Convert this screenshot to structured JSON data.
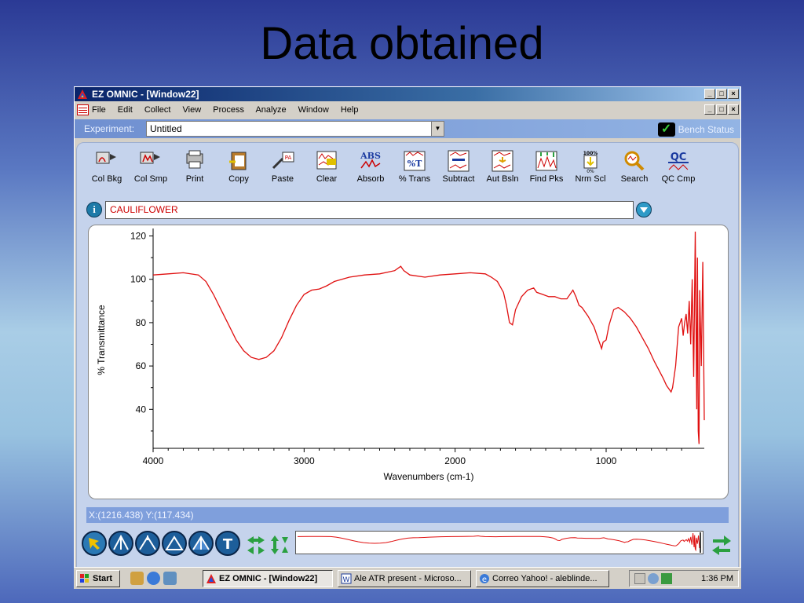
{
  "slide": {
    "title": "Data obtained"
  },
  "window": {
    "title": "EZ OMNIC - [Window22]",
    "controls": [
      "_",
      "□",
      "×"
    ]
  },
  "menu": {
    "items": [
      "File",
      "Edit",
      "Collect",
      "View",
      "Process",
      "Analyze",
      "Window",
      "Help"
    ]
  },
  "experiment": {
    "label": "Experiment:",
    "value": "Untitled",
    "bench_status": "Bench Status"
  },
  "toolbar": {
    "items": [
      {
        "label": "Col Bkg",
        "icon": "collect-background-icon"
      },
      {
        "label": "Col Smp",
        "icon": "collect-sample-icon"
      },
      {
        "label": "Print",
        "icon": "printer-icon"
      },
      {
        "label": "Copy",
        "icon": "clipboard-copy-icon"
      },
      {
        "label": "Paste",
        "icon": "paste-icon"
      },
      {
        "label": "Clear",
        "icon": "clear-icon"
      },
      {
        "label": "Absorb",
        "icon": "absorbance-icon",
        "glyph": "ABS"
      },
      {
        "label": "% Trans",
        "icon": "transmittance-icon",
        "glyph": "%T"
      },
      {
        "label": "Subtract",
        "icon": "subtract-icon"
      },
      {
        "label": "Aut Bsln",
        "icon": "auto-baseline-icon"
      },
      {
        "label": "Find Pks",
        "icon": "find-peaks-icon"
      },
      {
        "label": "Nrm Scl",
        "icon": "normal-scale-icon",
        "glyph": "100%"
      },
      {
        "label": "Search",
        "icon": "search-icon"
      },
      {
        "label": "QC Cmp",
        "icon": "qc-compare-icon",
        "glyph": "QC"
      }
    ]
  },
  "sample": {
    "name": "CAULIFLOWER"
  },
  "status": {
    "coordinates": "X:(1216.438) Y:(117.434)"
  },
  "taskbar": {
    "start": "Start",
    "buttons": [
      {
        "label": "EZ OMNIC - [Window22]",
        "active": true
      },
      {
        "label": "Ale ATR present - Microso...",
        "active": false
      },
      {
        "label": "Correo Yahoo! - aleblinde...",
        "active": false
      }
    ],
    "time": "1:36 PM"
  },
  "colors": {
    "spectrum": "#e01010",
    "panel": "#c5d3ec",
    "title_bar": "#0a246a"
  },
  "chart_data": {
    "type": "line",
    "title": "",
    "xlabel": "Wavenumbers (cm-1)",
    "ylabel": "% Transmittance",
    "xlim": [
      4000,
      350
    ],
    "ylim": [
      22,
      122
    ],
    "x_reversed": true,
    "x_ticks": [
      4000,
      3000,
      2000,
      1000
    ],
    "y_ticks": [
      40,
      60,
      80,
      100,
      120
    ],
    "grid": false,
    "series": [
      {
        "x": [
          4000,
          3900,
          3800,
          3700,
          3650,
          3600,
          3550,
          3500,
          3450,
          3400,
          3350,
          3300,
          3250,
          3200,
          3150,
          3100,
          3050,
          3000,
          2950,
          2900,
          2850,
          2800,
          2700,
          2600,
          2500,
          2400,
          2360,
          2340,
          2300,
          2200,
          2100,
          2000,
          1900,
          1800,
          1760,
          1720,
          1680,
          1660,
          1640,
          1620,
          1600,
          1560,
          1520,
          1480,
          1460,
          1420,
          1380,
          1340,
          1300,
          1260,
          1220,
          1200,
          1180,
          1160,
          1120,
          1080,
          1060,
          1040,
          1030,
          1020,
          1000,
          980,
          950,
          920,
          880,
          840,
          800,
          760,
          720,
          680,
          650,
          620,
          600,
          580,
          570,
          560,
          540,
          520,
          500,
          490,
          480,
          470,
          460,
          450,
          440,
          430,
          420,
          410,
          400,
          395,
          390,
          385,
          380,
          370,
          360,
          350
        ],
        "y": [
          102,
          102.5,
          103,
          102,
          99,
          93,
          86,
          79,
          72,
          67,
          64,
          63,
          64,
          67,
          73,
          81,
          88,
          93,
          95,
          95.5,
          97,
          99,
          101,
          102,
          102.5,
          104,
          106,
          104,
          102,
          101,
          102,
          102.5,
          103,
          102.5,
          101,
          99,
          94,
          88,
          80,
          79,
          86,
          92,
          95,
          96,
          94,
          93,
          92,
          92,
          91,
          91,
          95,
          92,
          88,
          87,
          83,
          78,
          74,
          70,
          68,
          71,
          72,
          79,
          86,
          87,
          85,
          82,
          78,
          73,
          68,
          62,
          58,
          54,
          51,
          49,
          48,
          50,
          60,
          78,
          82,
          74,
          80,
          84,
          75,
          90,
          70,
          100,
          55,
          122,
          40,
          110,
          30,
          24,
          95,
          60,
          108,
          35
        ]
      }
    ]
  }
}
